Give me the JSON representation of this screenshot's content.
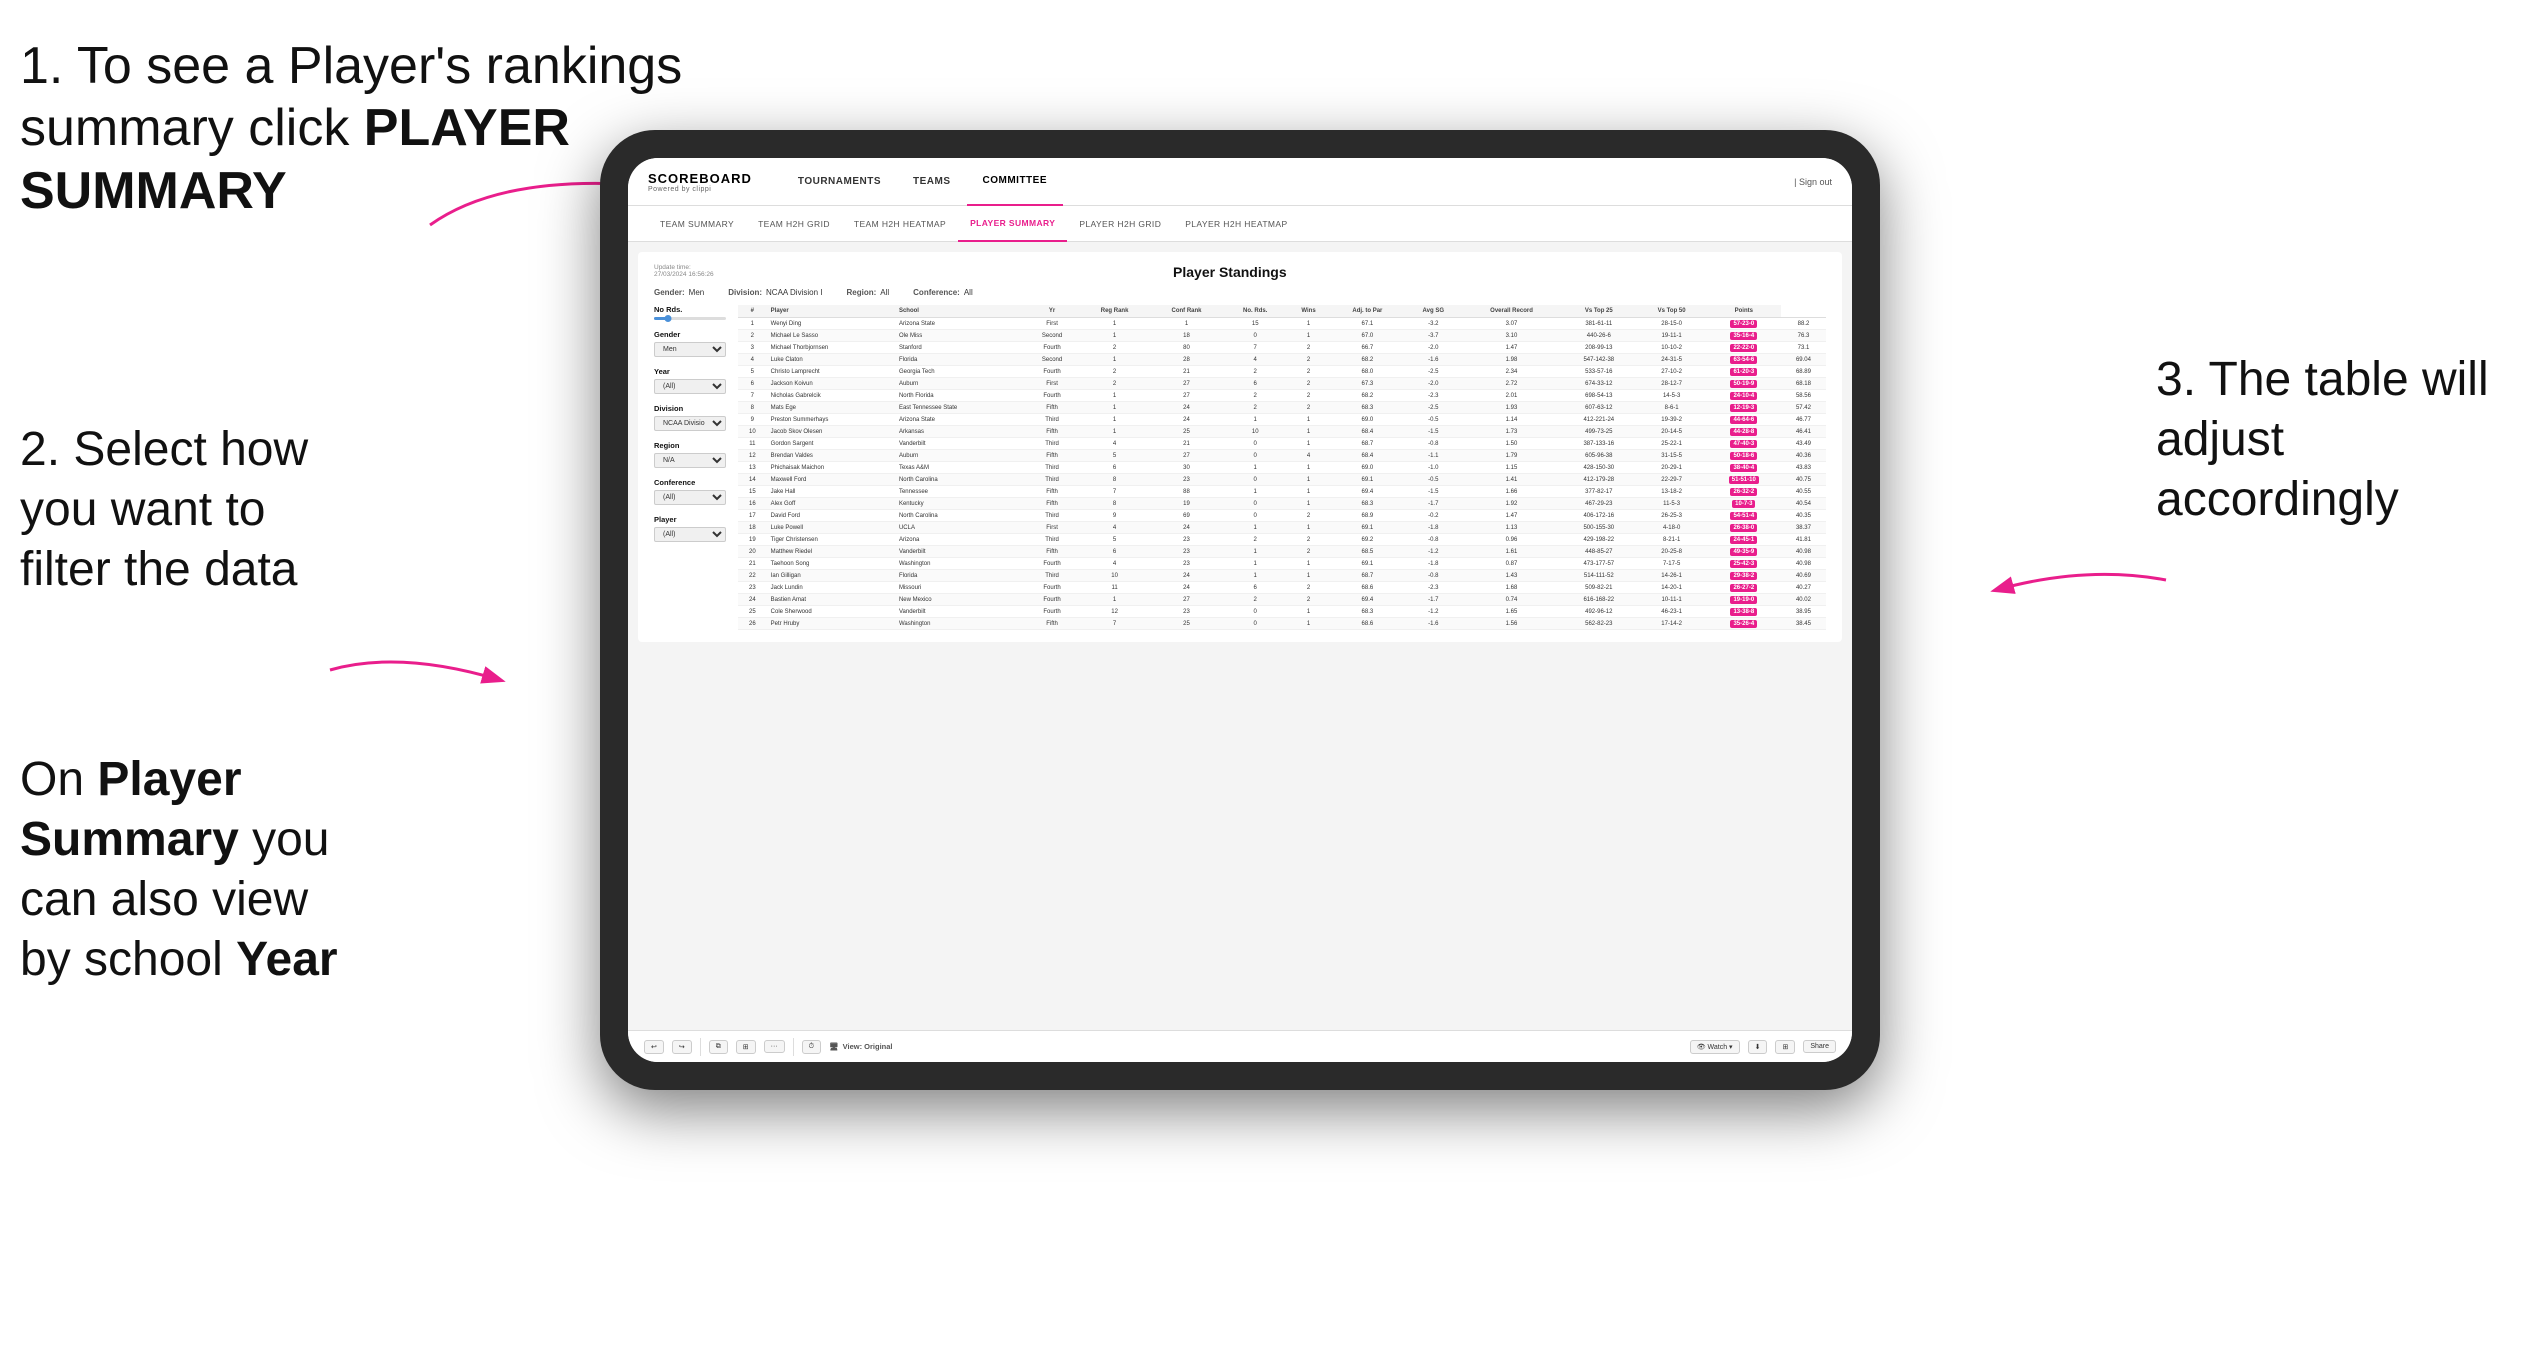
{
  "annotations": {
    "step1_line1": "1. To see a Player's rankings",
    "step1_line2": "summary click ",
    "step1_bold": "PLAYER SUMMARY",
    "step2_line1": "2. Select how",
    "step2_line2": "you want to",
    "step2_line3": "filter the data",
    "step3_line1": "3. The table will",
    "step3_line2": "adjust accordingly",
    "bottomleft_line1": "On ",
    "bottomleft_bold1": "Player",
    "bottomleft_line2": "Summary",
    "bottomleft_normal": " you",
    "bottomleft_line3": "can also view",
    "bottomleft_line4": "by school ",
    "bottomleft_bold2": "Year"
  },
  "app": {
    "logo_title": "SCOREBOARD",
    "logo_sub": "Powered by clippi",
    "nav_items": [
      "TOURNAMENTS",
      "TEAMS",
      "COMMITTEE"
    ],
    "nav_right_icon": "| Sign out",
    "sub_nav_items": [
      "TEAM SUMMARY",
      "TEAM H2H GRID",
      "TEAM H2H HEATMAP",
      "PLAYER SUMMARY",
      "PLAYER H2H GRID",
      "PLAYER H2H HEATMAP"
    ],
    "active_nav": "COMMITTEE",
    "active_sub": "PLAYER SUMMARY"
  },
  "panel": {
    "update_label": "Update time:",
    "update_time": "27/03/2024 16:56:26",
    "title": "Player Standings",
    "gender_label": "Gender:",
    "gender_value": "Men",
    "division_label": "Division:",
    "division_value": "NCAA Division I",
    "region_label": "Region:",
    "region_value": "All",
    "conference_label": "Conference:",
    "conference_value": "All"
  },
  "sidebar": {
    "no_rds_label": "No Rds.",
    "gender_label": "Gender",
    "gender_value": "Men",
    "year_label": "Year",
    "year_value": "(All)",
    "division_label": "Division",
    "division_value": "NCAA Division I",
    "region_label": "Region",
    "region_value": "N/A",
    "conference_label": "Conference",
    "conference_value": "(All)",
    "player_label": "Player",
    "player_value": "(All)"
  },
  "table": {
    "columns": [
      "#",
      "Player",
      "School",
      "Yr",
      "Reg Rank",
      "Conf Rank",
      "No. Rds.",
      "Wins",
      "Adj. to Par",
      "Avg SG",
      "Overall Record",
      "Vs Top 25",
      "Vs Top 50",
      "Points"
    ],
    "rows": [
      [
        "1",
        "Wenyi Ding",
        "Arizona State",
        "First",
        "1",
        "1",
        "15",
        "1",
        "67.1",
        "-3.2",
        "3.07",
        "381-61-11",
        "28-15-0",
        "57-23-0",
        "88.2"
      ],
      [
        "2",
        "Michael Le Sasso",
        "Ole Miss",
        "Second",
        "1",
        "18",
        "0",
        "1",
        "67.0",
        "-3.7",
        "3.10",
        "440-26-6",
        "19-11-1",
        "35-16-4",
        "76.3"
      ],
      [
        "3",
        "Michael Thorbjornsen",
        "Stanford",
        "Fourth",
        "2",
        "80",
        "7",
        "2",
        "66.7",
        "-2.0",
        "1.47",
        "208-99-13",
        "10-10-2",
        "22-22-0",
        "73.1"
      ],
      [
        "4",
        "Luke Claton",
        "Florida",
        "Second",
        "1",
        "28",
        "4",
        "2",
        "68.2",
        "-1.6",
        "1.98",
        "547-142-38",
        "24-31-5",
        "63-54-6",
        "69.04"
      ],
      [
        "5",
        "Christo Lamprecht",
        "Georgia Tech",
        "Fourth",
        "2",
        "21",
        "2",
        "2",
        "68.0",
        "-2.5",
        "2.34",
        "533-57-16",
        "27-10-2",
        "61-20-3",
        "68.89"
      ],
      [
        "6",
        "Jackson Koivun",
        "Auburn",
        "First",
        "2",
        "27",
        "6",
        "2",
        "67.3",
        "-2.0",
        "2.72",
        "674-33-12",
        "28-12-7",
        "50-19-9",
        "68.18"
      ],
      [
        "7",
        "Nicholas Gabrelcik",
        "North Florida",
        "Fourth",
        "1",
        "27",
        "2",
        "2",
        "68.2",
        "-2.3",
        "2.01",
        "698-54-13",
        "14-5-3",
        "24-10-4",
        "58.56"
      ],
      [
        "8",
        "Mats Ege",
        "East Tennessee State",
        "Fifth",
        "1",
        "24",
        "2",
        "2",
        "68.3",
        "-2.5",
        "1.93",
        "607-63-12",
        "8-6-1",
        "12-19-3",
        "57.42"
      ],
      [
        "9",
        "Preston Summerhays",
        "Arizona State",
        "Third",
        "1",
        "24",
        "1",
        "1",
        "69.0",
        "-0.5",
        "1.14",
        "412-221-24",
        "19-39-2",
        "44-64-6",
        "46.77"
      ],
      [
        "10",
        "Jacob Skov Olesen",
        "Arkansas",
        "Fifth",
        "1",
        "25",
        "10",
        "1",
        "68.4",
        "-1.5",
        "1.73",
        "499-73-25",
        "20-14-5",
        "44-28-8",
        "46.41"
      ],
      [
        "11",
        "Gordon Sargent",
        "Vanderbilt",
        "Third",
        "4",
        "21",
        "0",
        "1",
        "68.7",
        "-0.8",
        "1.50",
        "387-133-16",
        "25-22-1",
        "47-40-3",
        "43.49"
      ],
      [
        "12",
        "Brendan Valdes",
        "Auburn",
        "Fifth",
        "5",
        "27",
        "0",
        "4",
        "68.4",
        "-1.1",
        "1.79",
        "605-96-38",
        "31-15-5",
        "50-18-6",
        "40.36"
      ],
      [
        "13",
        "Phichaisak Maichon",
        "Texas A&M",
        "Third",
        "6",
        "30",
        "1",
        "1",
        "69.0",
        "-1.0",
        "1.15",
        "428-150-30",
        "20-29-1",
        "38-40-4",
        "43.83"
      ],
      [
        "14",
        "Maxwell Ford",
        "North Carolina",
        "Third",
        "8",
        "23",
        "0",
        "1",
        "69.1",
        "-0.5",
        "1.41",
        "412-179-28",
        "22-29-7",
        "51-51-10",
        "40.75"
      ],
      [
        "15",
        "Jake Hall",
        "Tennessee",
        "Fifth",
        "7",
        "88",
        "1",
        "1",
        "69.4",
        "-1.5",
        "1.66",
        "377-82-17",
        "13-18-2",
        "26-32-2",
        "40.55"
      ],
      [
        "16",
        "Alex Goff",
        "Kentucky",
        "Fifth",
        "8",
        "19",
        "0",
        "1",
        "68.3",
        "-1.7",
        "1.92",
        "467-29-23",
        "11-5-3",
        "10-7-3",
        "40.54"
      ],
      [
        "17",
        "David Ford",
        "North Carolina",
        "Third",
        "9",
        "69",
        "0",
        "2",
        "68.9",
        "-0.2",
        "1.47",
        "406-172-16",
        "26-25-3",
        "54-51-4",
        "40.35"
      ],
      [
        "18",
        "Luke Powell",
        "UCLA",
        "First",
        "4",
        "24",
        "1",
        "1",
        "69.1",
        "-1.8",
        "1.13",
        "500-155-30",
        "4-18-0",
        "26-38-0",
        "38.37"
      ],
      [
        "19",
        "Tiger Christensen",
        "Arizona",
        "Third",
        "5",
        "23",
        "2",
        "2",
        "69.2",
        "-0.8",
        "0.96",
        "429-198-22",
        "8-21-1",
        "24-45-1",
        "41.81"
      ],
      [
        "20",
        "Matthew Riedel",
        "Vanderbilt",
        "Fifth",
        "6",
        "23",
        "1",
        "2",
        "68.5",
        "-1.2",
        "1.61",
        "448-85-27",
        "20-25-8",
        "49-35-9",
        "40.98"
      ],
      [
        "21",
        "Taehoon Song",
        "Washington",
        "Fourth",
        "4",
        "23",
        "1",
        "1",
        "69.1",
        "-1.8",
        "0.87",
        "473-177-57",
        "7-17-5",
        "25-42-3",
        "40.98"
      ],
      [
        "22",
        "Ian Gilligan",
        "Florida",
        "Third",
        "10",
        "24",
        "1",
        "1",
        "68.7",
        "-0.8",
        "1.43",
        "514-111-52",
        "14-26-1",
        "29-38-2",
        "40.69"
      ],
      [
        "23",
        "Jack Lundin",
        "Missouri",
        "Fourth",
        "11",
        "24",
        "6",
        "2",
        "68.6",
        "-2.3",
        "1.68",
        "509-82-21",
        "14-20-1",
        "26-27-2",
        "40.27"
      ],
      [
        "24",
        "Bastien Amat",
        "New Mexico",
        "Fourth",
        "1",
        "27",
        "2",
        "2",
        "69.4",
        "-1.7",
        "0.74",
        "616-168-22",
        "10-11-1",
        "19-19-0",
        "40.02"
      ],
      [
        "25",
        "Cole Sherwood",
        "Vanderbilt",
        "Fourth",
        "12",
        "23",
        "0",
        "1",
        "68.3",
        "-1.2",
        "1.65",
        "492-96-12",
        "46-23-1",
        "13-38-8",
        "38.95"
      ],
      [
        "26",
        "Petr Hruby",
        "Washington",
        "Fifth",
        "7",
        "25",
        "0",
        "1",
        "68.6",
        "-1.6",
        "1.56",
        "562-82-23",
        "17-14-2",
        "35-26-4",
        "38.45"
      ]
    ]
  },
  "toolbar": {
    "view_label": "View: Original",
    "watch_label": "Watch",
    "share_label": "Share"
  }
}
